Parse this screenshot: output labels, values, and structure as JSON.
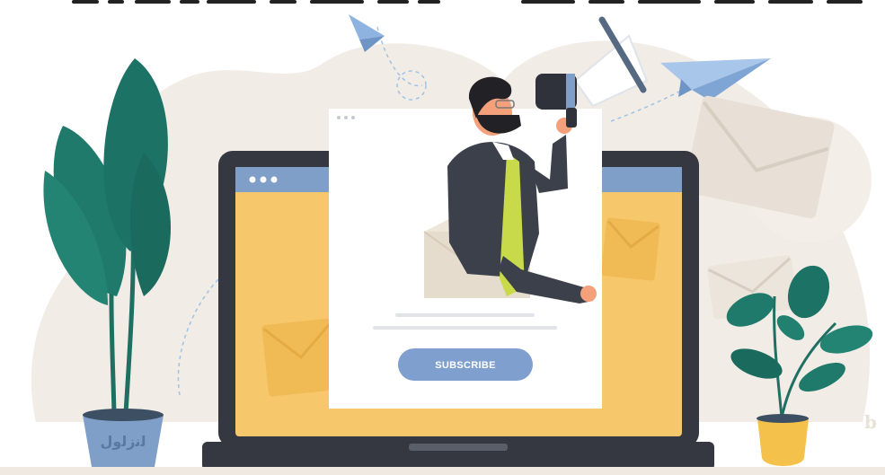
{
  "subscribe": {
    "label": "SUBSCRIBE"
  },
  "watermark": {
    "text": "b"
  },
  "pot_logo": {
    "text": "ﻟﻧﺯﻟﻭﻝ"
  },
  "colors": {
    "background_blob": "#f1ece6",
    "laptop_frame": "#3a3d45",
    "screen_yellow": "#f6c86b",
    "screen_bar": "#7f9fc8",
    "envelope": "#efe6da",
    "subscribe_button": "#7f9fcf",
    "plant_green": "#1f7a6b",
    "pot_blue": "#7f9fc8",
    "pot_yellow": "#f4c14a",
    "paper_plane": "#8fb3e0"
  }
}
